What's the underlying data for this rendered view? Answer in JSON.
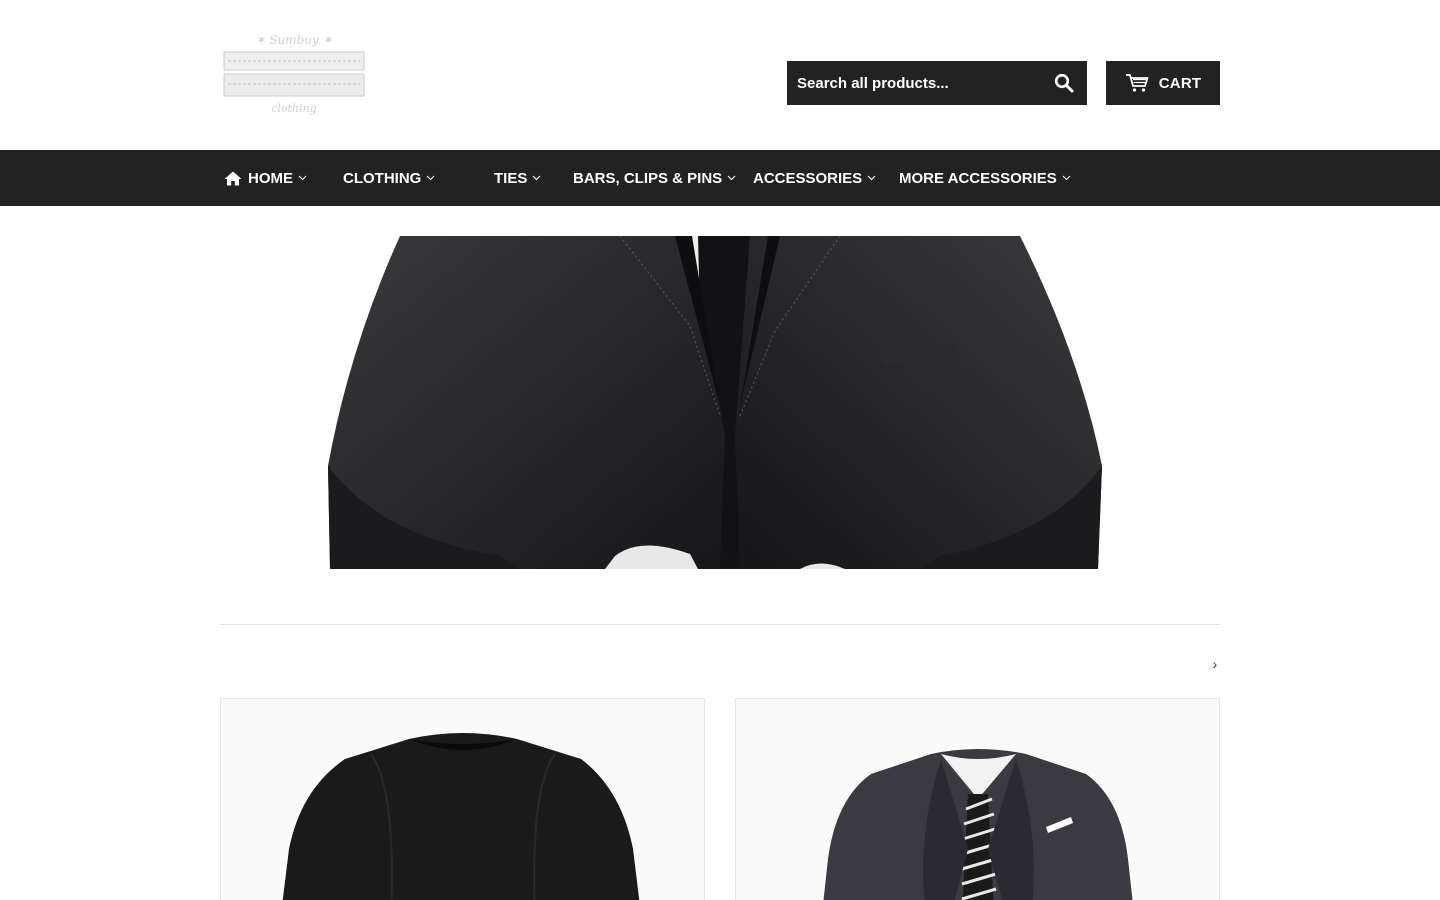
{
  "store": {
    "logo_alt_text": "Sumbuy Gentlemen's Clothing"
  },
  "search": {
    "placeholder": "Search all products..."
  },
  "cart": {
    "label": "CART"
  },
  "nav": {
    "items": [
      {
        "label": "HOME",
        "icon": "home-icon",
        "dropdown": true
      },
      {
        "label": "CLOTHING",
        "dropdown": true
      },
      {
        "label": "TIES",
        "dropdown": true
      },
      {
        "label": "BARS, CLIPS & PINS",
        "dropdown": true
      },
      {
        "label": "ACCESSORIES",
        "dropdown": true
      },
      {
        "label": "MORE ACCESSORIES",
        "dropdown": true
      }
    ]
  },
  "carousel": {
    "next_label": "›"
  },
  "colors": {
    "header_dark": "#222222",
    "background": "#ffffff",
    "divider": "#e4e4e4"
  }
}
